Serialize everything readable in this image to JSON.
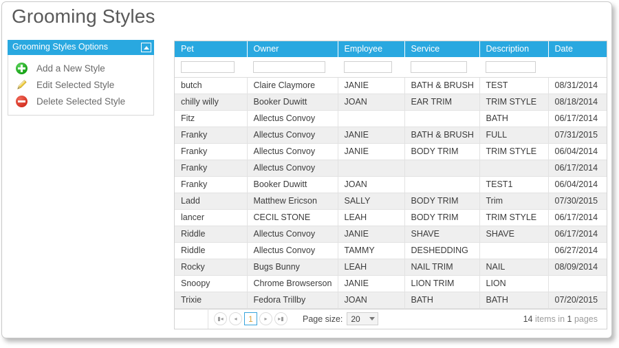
{
  "page": {
    "title": "Grooming Styles"
  },
  "options_panel": {
    "header_title": "Grooming Styles Options",
    "collapse_icon": "chevron-up-icon",
    "items": [
      {
        "label": "Add a New Style",
        "icon": "plus-circle-icon"
      },
      {
        "label": "Edit Selected Style",
        "icon": "pencil-icon"
      },
      {
        "label": "Delete Selected Style",
        "icon": "minus-circle-icon"
      }
    ]
  },
  "grid": {
    "columns": [
      "Pet",
      "Owner",
      "Employee",
      "Service",
      "Description",
      "Date"
    ],
    "filters": [
      {
        "value": "",
        "placeholder": ""
      },
      {
        "value": "",
        "placeholder": ""
      },
      {
        "value": "",
        "placeholder": ""
      },
      {
        "value": "",
        "placeholder": ""
      },
      {
        "value": "",
        "placeholder": ""
      }
    ],
    "rows": [
      {
        "pet": "butch",
        "owner": "Claire Claymore",
        "employee": "JANIE",
        "service": "BATH & BRUSH",
        "description": "TEST",
        "date": "08/31/2014"
      },
      {
        "pet": "chilly willy",
        "owner": "Booker Duwitt",
        "employee": "JOAN",
        "service": "EAR TRIM",
        "description": "TRIM STYLE",
        "date": "08/18/2014"
      },
      {
        "pet": "Fitz",
        "owner": "Allectus Convoy",
        "employee": "",
        "service": "",
        "description": "BATH",
        "date": "06/17/2014"
      },
      {
        "pet": "Franky",
        "owner": "Allectus Convoy",
        "employee": "JANIE",
        "service": "BATH & BRUSH",
        "description": "FULL",
        "date": "07/31/2015"
      },
      {
        "pet": "Franky",
        "owner": "Allectus Convoy",
        "employee": "JANIE",
        "service": "BODY TRIM",
        "description": "TRIM STYLE",
        "date": "06/04/2014"
      },
      {
        "pet": "Franky",
        "owner": "Allectus Convoy",
        "employee": "",
        "service": "",
        "description": "",
        "date": "06/17/2014"
      },
      {
        "pet": "Franky",
        "owner": "Booker Duwitt",
        "employee": "JOAN",
        "service": "",
        "description": "TEST1",
        "date": "06/04/2014"
      },
      {
        "pet": "Ladd",
        "owner": "Matthew Ericson",
        "employee": "SALLY",
        "service": "BODY TRIM",
        "description": "Trim",
        "date": "07/30/2015"
      },
      {
        "pet": "lancer",
        "owner": "CECIL STONE",
        "employee": "LEAH",
        "service": "BODY TRIM",
        "description": "TRIM STYLE",
        "date": "06/17/2014"
      },
      {
        "pet": "Riddle",
        "owner": "Allectus Convoy",
        "employee": "JANIE",
        "service": "SHAVE",
        "description": "SHAVE",
        "date": "06/17/2014"
      },
      {
        "pet": "Riddle",
        "owner": "Allectus Convoy",
        "employee": "TAMMY",
        "service": "DESHEDDING",
        "description": "",
        "date": "06/27/2014"
      },
      {
        "pet": "Rocky",
        "owner": "Bugs Bunny",
        "employee": "LEAH",
        "service": "NAIL TRIM",
        "description": "NAIL",
        "date": "08/09/2014"
      },
      {
        "pet": "Snoopy",
        "owner": "Chrome Browserson",
        "employee": "JANIE",
        "service": "LION TRIM",
        "description": "LION",
        "date": ""
      },
      {
        "pet": "Trixie",
        "owner": "Fedora Trillby",
        "employee": "JOAN",
        "service": "BATH",
        "description": "BATH",
        "date": "07/20/2015"
      }
    ]
  },
  "pager": {
    "first_icon": "first-page-icon",
    "prev_icon": "previous-page-icon",
    "current_page": "1",
    "next_icon": "next-page-icon",
    "last_icon": "last-page-icon",
    "page_size_label": "Page size:",
    "page_size_value": "20",
    "info_count": "14",
    "info_middle": " items in ",
    "info_pages": "1",
    "info_suffix": " pages"
  },
  "colors": {
    "accent_blue": "#29a8e0",
    "title_grey": "#595959",
    "row_alt": "#efefef",
    "add_green": "#14a014",
    "delete_red": "#d32e1f",
    "pencil_yellow": "#e8c547",
    "current_page_text": "#d8a441"
  }
}
